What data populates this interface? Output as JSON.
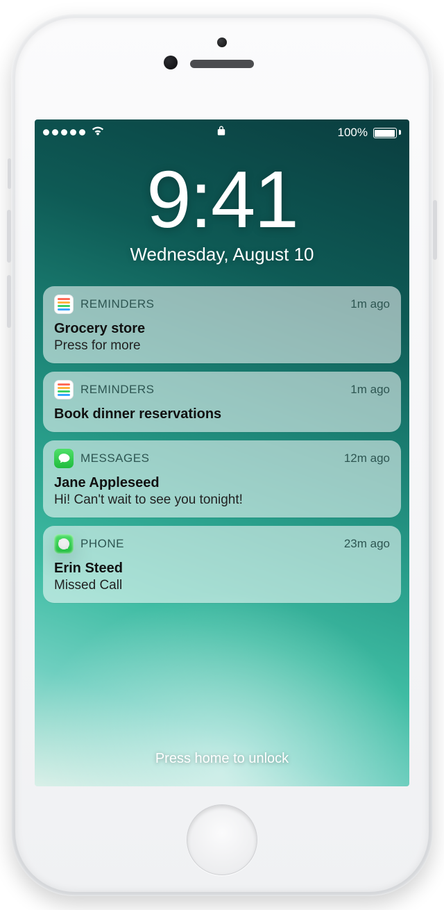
{
  "status_bar": {
    "signal_dots": 5,
    "battery_pct": "100%"
  },
  "clock": {
    "time": "9:41",
    "date": "Wednesday, August 10"
  },
  "unlock_hint": "Press home to unlock",
  "notifications": [
    {
      "icon": "reminders",
      "app": "REMINDERS",
      "time_ago": "1m ago",
      "title": "Grocery store",
      "body": "Press for more"
    },
    {
      "icon": "reminders",
      "app": "REMINDERS",
      "time_ago": "1m ago",
      "title": "Book dinner reservations",
      "body": ""
    },
    {
      "icon": "messages",
      "app": "MESSAGES",
      "time_ago": "12m ago",
      "title": "Jane Appleseed",
      "body": "Hi! Can't wait to see you tonight!"
    },
    {
      "icon": "phone",
      "app": "PHONE",
      "time_ago": "23m ago",
      "title": "Erin Steed",
      "body": "Missed Call"
    }
  ]
}
